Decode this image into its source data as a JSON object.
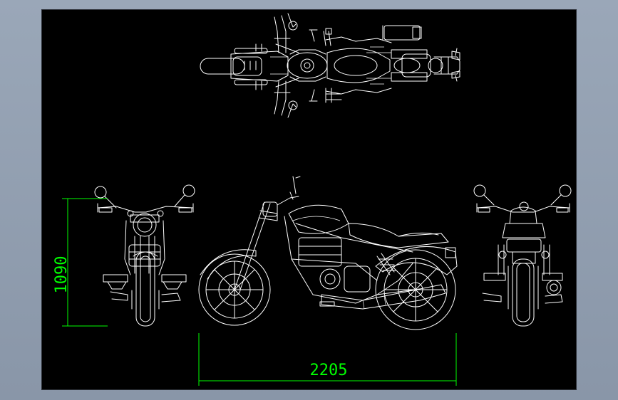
{
  "drawing": {
    "views": [
      "top-view",
      "front-view",
      "side-view",
      "rear-view"
    ],
    "colors": {
      "background": "#000000",
      "lines": "#ffffff",
      "dimensions": "#00ff00",
      "frame": "#9aa7b8"
    }
  },
  "dimensions": {
    "height": "1090",
    "length": "2205"
  }
}
